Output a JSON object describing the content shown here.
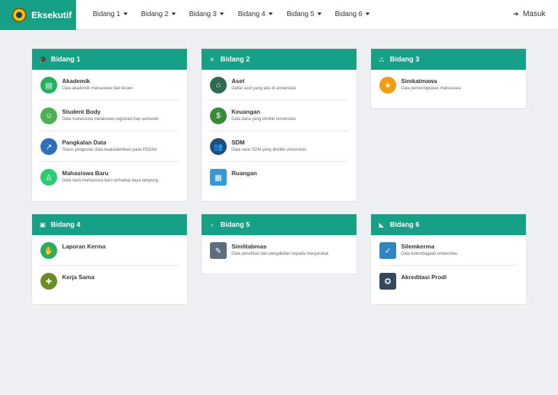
{
  "brand": {
    "name": "Eksekutif",
    "color": "#16a085"
  },
  "nav": {
    "menus": [
      "Bidang 1",
      "Bidang 2",
      "Bidang 3",
      "Bidang 4",
      "Bidang 5",
      "Bidang 6"
    ],
    "login_label": "Masuk",
    "login_icon": "sign-in-icon"
  },
  "cards": [
    {
      "title": "Bidang 1",
      "icon": "graduation-cap-icon",
      "items": [
        {
          "title": "Akademik",
          "desc": "Data akademik mahasiswa dan dosen",
          "icon": "academic-icon"
        },
        {
          "title": "Student Body",
          "desc": "Data mahasiswa melakukan registrasi tiap semester",
          "icon": "student-body-icon"
        },
        {
          "title": "Pangkalan Data",
          "desc": "Status pelaporan data keakademikan pada PDDikti",
          "icon": "chart-growth-icon"
        },
        {
          "title": "Mahasiswa Baru",
          "desc": "Data rasio mahasiswa baru terhadap daya tampung",
          "icon": "new-student-icon"
        }
      ]
    },
    {
      "title": "Bidang 2",
      "icon": "list-icon",
      "items": [
        {
          "title": "Aset",
          "desc": "Daftar aset yang ada di universitas",
          "icon": "asset-icon"
        },
        {
          "title": "Keuangan",
          "desc": "Data dana yang dimiliki universitas",
          "icon": "money-icon"
        },
        {
          "title": "SDM",
          "desc": "Data rasio SDM yang dimiliki universitas",
          "icon": "people-icon"
        },
        {
          "title": "Ruangan",
          "desc": "",
          "icon": "building-icon"
        }
      ]
    },
    {
      "title": "Bidang 3",
      "icon": "sitemap-icon",
      "items": [
        {
          "title": "Simkatmawa",
          "desc": "Data pemeringkatan mahasiswa",
          "icon": "medal-icon"
        }
      ]
    },
    {
      "title": "Bidang 4",
      "icon": "briefcase-icon",
      "items": [
        {
          "title": "Laporan Kerma",
          "desc": "",
          "icon": "handshake-icon"
        },
        {
          "title": "Kerja Sama",
          "desc": "",
          "icon": "cooperation-icon"
        }
      ]
    },
    {
      "title": "Bidang 5",
      "icon": "lightbulb-icon",
      "items": [
        {
          "title": "Simlitabmas",
          "desc": "Data penelitian dan pengabdian kepada masyarakat",
          "icon": "research-icon"
        }
      ]
    },
    {
      "title": "Bidang 6",
      "icon": "rss-icon",
      "items": [
        {
          "title": "Silemkerma",
          "desc": "Data kelembagaan universitas",
          "icon": "clipboard-check-icon"
        },
        {
          "title": "Akreditasi Prodi",
          "desc": "",
          "icon": "certificate-icon"
        }
      ]
    }
  ]
}
